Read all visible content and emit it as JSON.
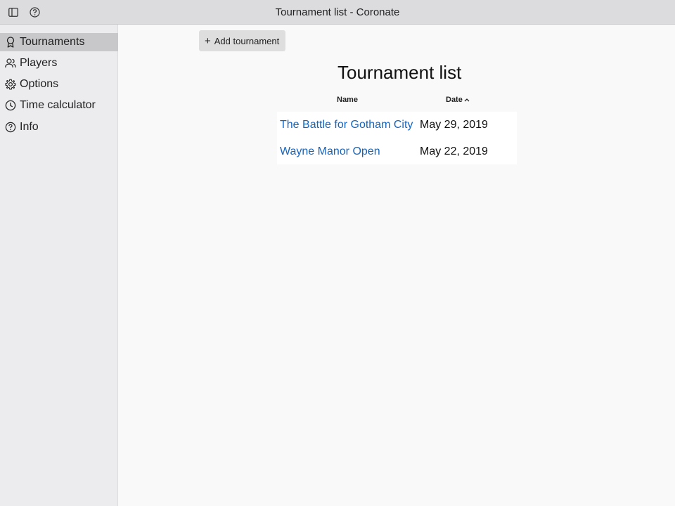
{
  "window": {
    "title": "Tournament list - Coronate",
    "icons": [
      "sidebar-toggle-icon",
      "help-circle-icon"
    ]
  },
  "sidebar": {
    "items": [
      {
        "label": "Tournaments",
        "icon": "award-icon",
        "active": true
      },
      {
        "label": "Players",
        "icon": "users-icon",
        "active": false
      },
      {
        "label": "Options",
        "icon": "gear-icon",
        "active": false
      },
      {
        "label": "Time calculator",
        "icon": "clock-icon",
        "active": false
      },
      {
        "label": "Info",
        "icon": "help-circle-icon",
        "active": false
      }
    ]
  },
  "main": {
    "add_button_label": "Add tournament",
    "page_title": "Tournament list",
    "columns": {
      "name": "Name",
      "date": "Date",
      "date_sort": "ascending"
    },
    "rows": [
      {
        "name": "The Battle for Gotham City",
        "date": "May 29, 2019"
      },
      {
        "name": "Wayne Manor Open",
        "date": "May 22, 2019"
      }
    ]
  },
  "colors": {
    "link": "#1565c0",
    "active_nav": "#c8c8ca",
    "sidebar_bg": "#ececee",
    "titlebar_bg": "#dcdbde"
  }
}
